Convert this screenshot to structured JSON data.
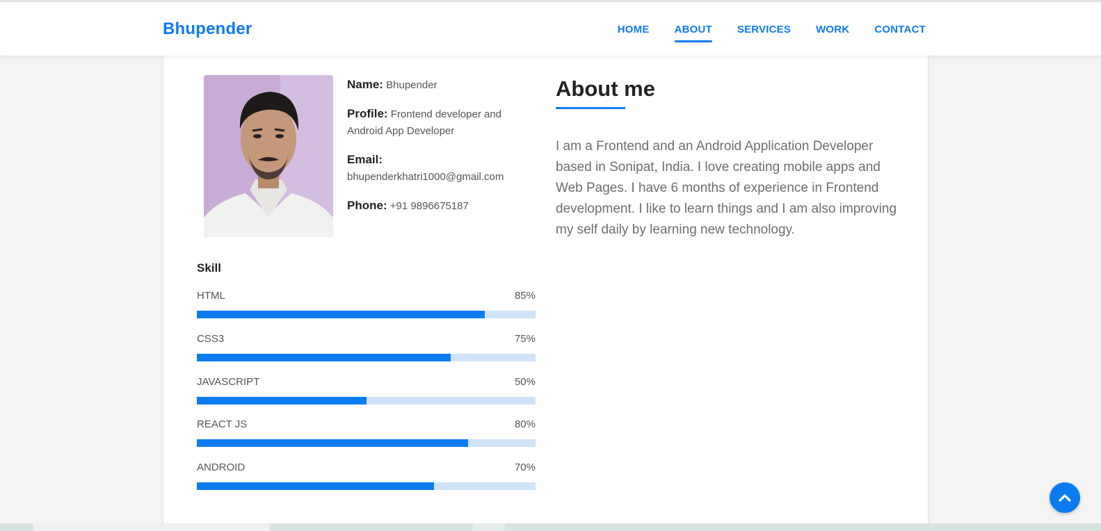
{
  "header": {
    "brand": "Bhupender",
    "nav": [
      {
        "label": "HOME",
        "active": false
      },
      {
        "label": "ABOUT",
        "active": true
      },
      {
        "label": "SERVICES",
        "active": false
      },
      {
        "label": "WORK",
        "active": false
      },
      {
        "label": "CONTACT",
        "active": false
      }
    ]
  },
  "profile": {
    "name_label": "Name:",
    "name_value": "Bhupender",
    "profile_label": "Profile:",
    "profile_value": "Frontend developer and Android App Developer",
    "email_label": "Email:",
    "email_value": "bhupenderkhatri1000@gmail.com",
    "phone_label": "Phone:",
    "phone_value": "+91 9896675187"
  },
  "skills": {
    "title": "Skill",
    "items": [
      {
        "name": "HTML",
        "label": "85%",
        "value": 85
      },
      {
        "name": "CSS3",
        "label": "75%",
        "value": 75
      },
      {
        "name": "JAVASCRIPT",
        "label": "50%",
        "value": 50
      },
      {
        "name": "REACT JS",
        "label": "80%",
        "value": 80
      },
      {
        "name": "ANDROID",
        "label": "70%",
        "value": 70
      }
    ]
  },
  "about": {
    "title": "About me",
    "text": "I am a Frontend and an Android Application Developer based in Sonipat, India. I love creating mobile apps and Web Pages. I have 6 months of experience in Frontend development. I like to learn things and I am also improving my self daily by learning new technology."
  },
  "colors": {
    "accent": "#0d7bf0",
    "bar_track": "#cfe2f8"
  },
  "icons": {
    "scroll_top": "chevron-up-icon"
  }
}
